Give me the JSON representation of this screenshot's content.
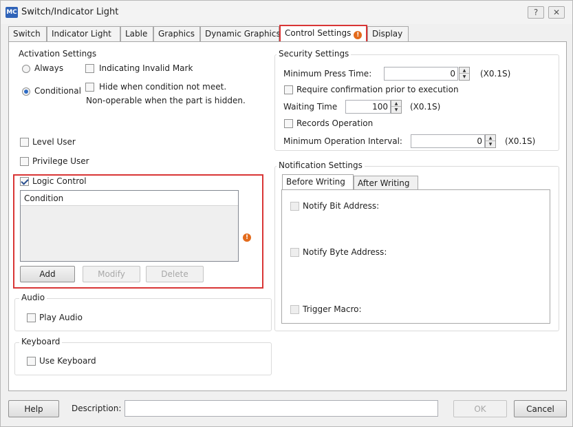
{
  "window": {
    "app_icon_text": "MC",
    "title": "Switch/Indicator Light",
    "help_button_label": "?",
    "close_button_label": "✕"
  },
  "tabs": [
    {
      "label": "Switch"
    },
    {
      "label": "Indicator Light"
    },
    {
      "label": "Lable"
    },
    {
      "label": "Graphics"
    },
    {
      "label": "Dynamic Graphics"
    },
    {
      "label": "Control Settings",
      "active": true,
      "warning": true
    },
    {
      "label": "Display"
    }
  ],
  "warning_glyph": "!",
  "activation": {
    "title": "Activation Settings",
    "always_label": "Always",
    "conditional_label": "Conditional",
    "selected": "Conditional",
    "invalid_mark_label": "Indicating Invalid Mark",
    "hide_label": "Hide when condition not meet.",
    "non_operable_note": "Non-operable when the part is hidden."
  },
  "level_user_label": "Level User",
  "privilege_user_label": "Privilege User",
  "logic_control": {
    "label": "Logic Control",
    "checked": true,
    "table_header": "Condition",
    "add_label": "Add",
    "modify_label": "Modify",
    "delete_label": "Delete"
  },
  "audio": {
    "title": "Audio",
    "play_label": "Play Audio"
  },
  "keyboard": {
    "title": "Keyboard",
    "use_label": "Use Keyboard"
  },
  "security": {
    "title": "Security Settings",
    "min_press_label": "Minimum Press Time:",
    "min_press_value": "0",
    "min_press_unit": "(X0.1S)",
    "require_confirm_label": "Require confirmation prior to execution",
    "waiting_label": "Waiting Time",
    "waiting_value": "100",
    "waiting_unit": "(X0.1S)",
    "records_label": "Records Operation",
    "min_interval_label": "Minimum Operation Interval:",
    "min_interval_value": "0",
    "min_interval_unit": "(X0.1S)"
  },
  "notification": {
    "title": "Notification Settings",
    "tabs": [
      {
        "label": "Before Writing"
      },
      {
        "label": "After Writing"
      }
    ],
    "notify_bit_label": "Notify Bit Address:",
    "notify_byte_label": "Notify Byte Address:",
    "trigger_macro_label": "Trigger Macro:"
  },
  "footer": {
    "help_label": "Help",
    "description_label": "Description:",
    "description_value": "",
    "ok_label": "OK",
    "cancel_label": "Cancel"
  },
  "colors": {
    "highlight": "#d93535",
    "warning": "#e36b1c",
    "radio_selected": "#2e6bc4"
  }
}
